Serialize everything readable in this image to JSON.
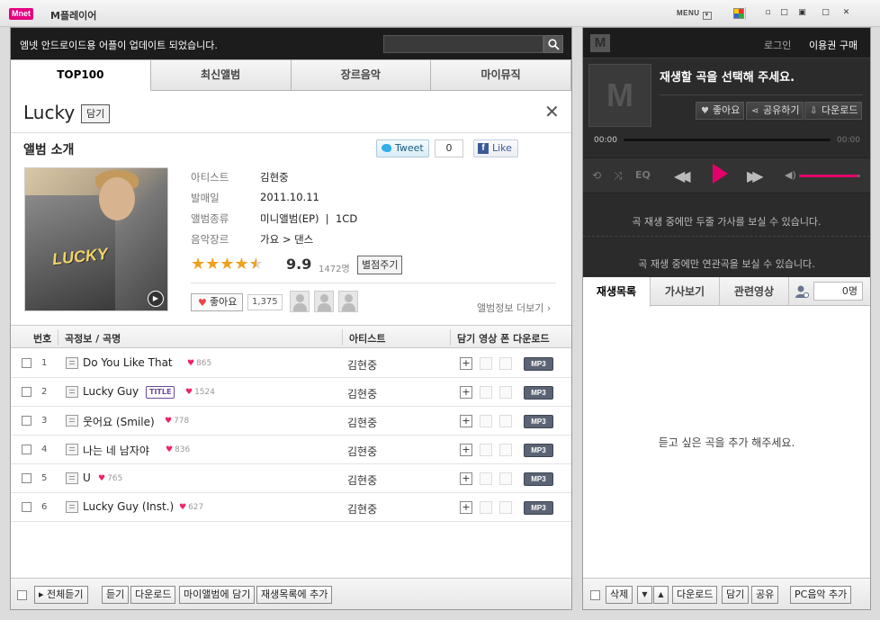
{
  "window": {
    "logo": "Mnet",
    "title": "M플레이어",
    "menu_label": "MENU",
    "minimize": "▫",
    "restore": "□",
    "maximize": "▣",
    "close": "✕"
  },
  "notice": {
    "text": "엠넷 안드로이드용 어플이 업데이트 되었습니다.",
    "search_value": ""
  },
  "tabs": [
    "TOP100",
    "최신앨범",
    "장르음악",
    "마이뮤직"
  ],
  "album": {
    "title": "Lucky",
    "add_label": "담기",
    "intro_label": "앨범 소개",
    "tweet_label": "Tweet",
    "tweet_count": "0",
    "like_label": "Like",
    "cover_text": "LUCKY",
    "info": [
      {
        "key": "아티스트",
        "value": "김현중"
      },
      {
        "key": "발매일",
        "value": "2011.10.11"
      },
      {
        "key": "앨범종류",
        "value": "미니앨범(EP)  |  1CD"
      },
      {
        "key": "음악장르",
        "value": "가요 > 댄스"
      }
    ],
    "stars": "★★★★",
    "star_half": "★",
    "rating_value": 4.5,
    "rating": "9.9",
    "votes": "1472명",
    "rate_label": "별점주기",
    "like_btn": "좋아요",
    "like_count": "1,375",
    "more_info": "앨범정보 더보기 ›"
  },
  "table": {
    "headers": {
      "num": "번호",
      "title": "곡정보 / 곡명",
      "artist": "아티스트",
      "actions": "담기 영상 폰 다운로드"
    },
    "rows": [
      {
        "num": "1",
        "title": "Do You Like That",
        "badge": "",
        "likes": "865",
        "artist": "김현중"
      },
      {
        "num": "2",
        "title": "Lucky Guy",
        "badge": "TITLE",
        "likes": "1524",
        "artist": "김현중"
      },
      {
        "num": "3",
        "title": "웃어요 (Smile)",
        "badge": "",
        "likes": "778",
        "artist": "김현중"
      },
      {
        "num": "4",
        "title": "나는 네 남자야",
        "badge": "",
        "likes": "836",
        "artist": "김현중"
      },
      {
        "num": "5",
        "title": "U",
        "badge": "",
        "likes": "765",
        "artist": "김현중"
      },
      {
        "num": "6",
        "title": "Lucky Guy (Inst.)",
        "badge": "",
        "likes": "627",
        "artist": "김현중"
      }
    ],
    "mp3_label": "MP3"
  },
  "left_bottom": [
    "▸ 전체듣기",
    "듣기",
    "다운로드",
    "마이앨범에 담기",
    "재생목록에 추가"
  ],
  "player": {
    "logo": "M",
    "login": "로그인",
    "voucher": "이용권 구매",
    "now_playing": "재생할 곡을 선택해 주세요.",
    "like_label": "좋아요",
    "share_label": "공유하기",
    "download_label": "다운로드",
    "time_start": "00:00",
    "time_end": "00:00",
    "eq_label": "EQ",
    "volume_level": 0.95,
    "lyric_msg": "곡 재생 중에만 두줄 가사를 보실 수 있습니다.",
    "related_msg": "곡 재생 중에만 연관곡을 보실 수 있습니다."
  },
  "right_tabs": [
    "재생목록",
    "가사보기",
    "관련영상"
  ],
  "user_count": "0명",
  "playlist_empty": "듣고 싶은 곡을 추가 해주세요.",
  "right_bottom": {
    "delete": "삭제",
    "down": "▼",
    "up": "▲",
    "download": "다운로드",
    "add": "담기",
    "share": "공유",
    "pc": "PC음악 추가"
  }
}
